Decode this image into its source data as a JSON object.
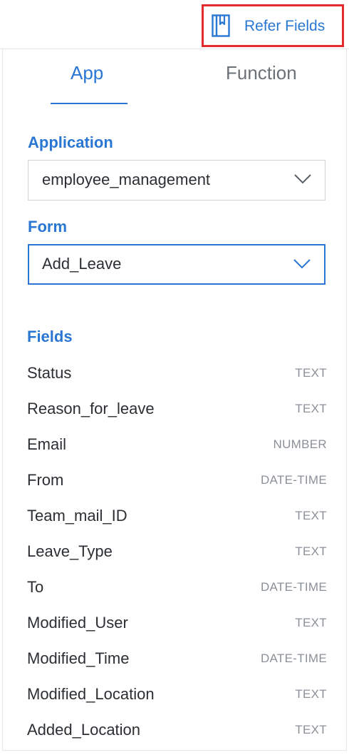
{
  "header": {
    "refer_fields_label": "Refer Fields",
    "refer_icon": "book-bookmark-icon",
    "highlight_color": "#e32b2b"
  },
  "tabs": [
    {
      "label": "App",
      "active": true
    },
    {
      "label": "Function",
      "active": false
    }
  ],
  "application": {
    "label": "Application",
    "selected": "employee_management"
  },
  "form": {
    "label": "Form",
    "selected": "Add_Leave"
  },
  "fields": {
    "label": "Fields",
    "items": [
      {
        "name": "Status",
        "type": "TEXT"
      },
      {
        "name": "Reason_for_leave",
        "type": "TEXT"
      },
      {
        "name": "Email",
        "type": "NUMBER"
      },
      {
        "name": "From",
        "type": "DATE-TIME"
      },
      {
        "name": "Team_mail_ID",
        "type": "TEXT"
      },
      {
        "name": "Leave_Type",
        "type": "TEXT"
      },
      {
        "name": "To",
        "type": "DATE-TIME"
      },
      {
        "name": "Modified_User",
        "type": "TEXT"
      },
      {
        "name": "Modified_Time",
        "type": "DATE-TIME"
      },
      {
        "name": "Modified_Location",
        "type": "TEXT"
      },
      {
        "name": "Added_Location",
        "type": "TEXT"
      }
    ]
  },
  "colors": {
    "accent": "#2a77d3",
    "text": "#2b2f33",
    "muted": "#8a9098"
  }
}
